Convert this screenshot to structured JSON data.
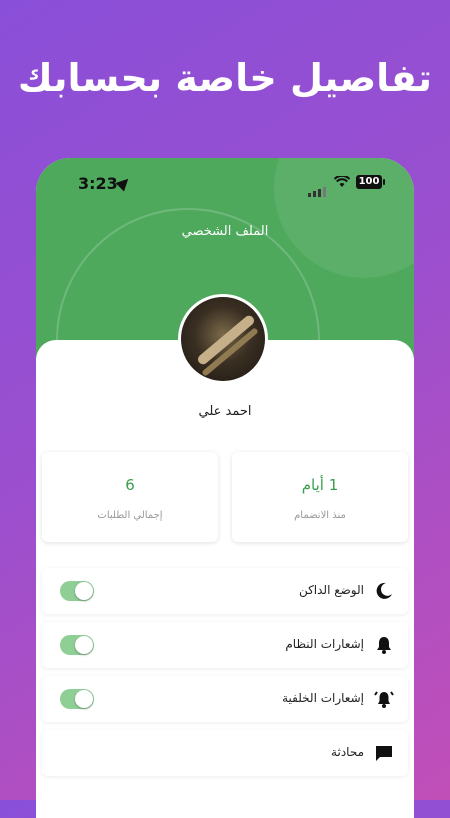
{
  "promo": {
    "title": "تفاصيل خاصة بحسابك"
  },
  "status_bar": {
    "time": "3:23",
    "battery": "100"
  },
  "header": {
    "title": "الملف الشخصي"
  },
  "profile": {
    "name": "احمد علي"
  },
  "stats": [
    {
      "value": "1 أيام",
      "label": "منذ الانضمام"
    },
    {
      "value": "6",
      "label": "إجمالي الطلبات"
    }
  ],
  "settings": [
    {
      "label": "الوضع الداكن",
      "icon": "moon-icon",
      "toggle": true
    },
    {
      "label": "إشعارات النظام",
      "icon": "bell-icon",
      "toggle": true
    },
    {
      "label": "إشعارات الخلفية",
      "icon": "alarm-bell-icon",
      "toggle": true
    },
    {
      "label": "محادثة",
      "icon": "chat-icon",
      "toggle": null
    }
  ],
  "colors": {
    "accent": "#4ea95d",
    "toggle_on": "#8fcf96",
    "value_text": "#3a9e4d"
  }
}
